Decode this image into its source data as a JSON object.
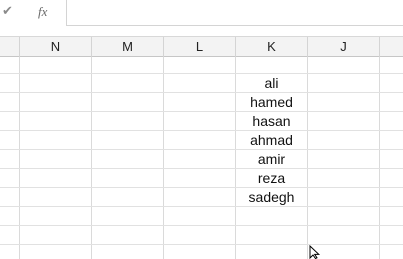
{
  "formula_bar": {
    "cancel_icon": "check-icon",
    "fx_label": "fx",
    "value": ""
  },
  "columns": [
    {
      "name": "N"
    },
    {
      "name": "M"
    },
    {
      "name": "L"
    },
    {
      "name": "K"
    },
    {
      "name": "J"
    }
  ],
  "column_k_values": [
    "ali",
    "hamed",
    "hasan",
    "ahmad",
    "amir",
    "reza",
    "sadegh"
  ]
}
